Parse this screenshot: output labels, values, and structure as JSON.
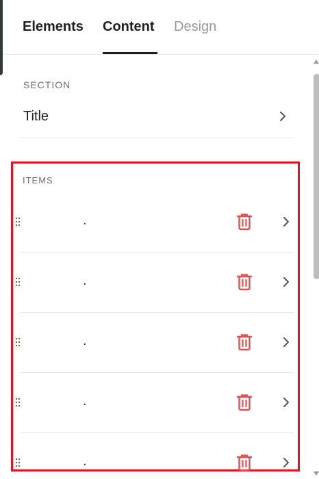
{
  "tabs": [
    {
      "label": "Elements"
    },
    {
      "label": "Content",
      "active": true
    },
    {
      "label": "Design"
    }
  ],
  "section": {
    "label": "SECTION",
    "title_row": {
      "label": "Title"
    }
  },
  "items": {
    "label": "ITEMS",
    "rows": [
      {
        "text": "."
      },
      {
        "text": "."
      },
      {
        "text": "."
      },
      {
        "text": "."
      },
      {
        "text": "."
      }
    ]
  },
  "colors": {
    "accent_text": "#1f1f1f",
    "muted_text": "#9a9a9a",
    "delete_red": "#e05252",
    "highlight_border": "#e3141f"
  },
  "icons": {
    "chevron": "chevron-right-icon",
    "trash": "trash-icon",
    "drag": "drag-handle-icon"
  }
}
